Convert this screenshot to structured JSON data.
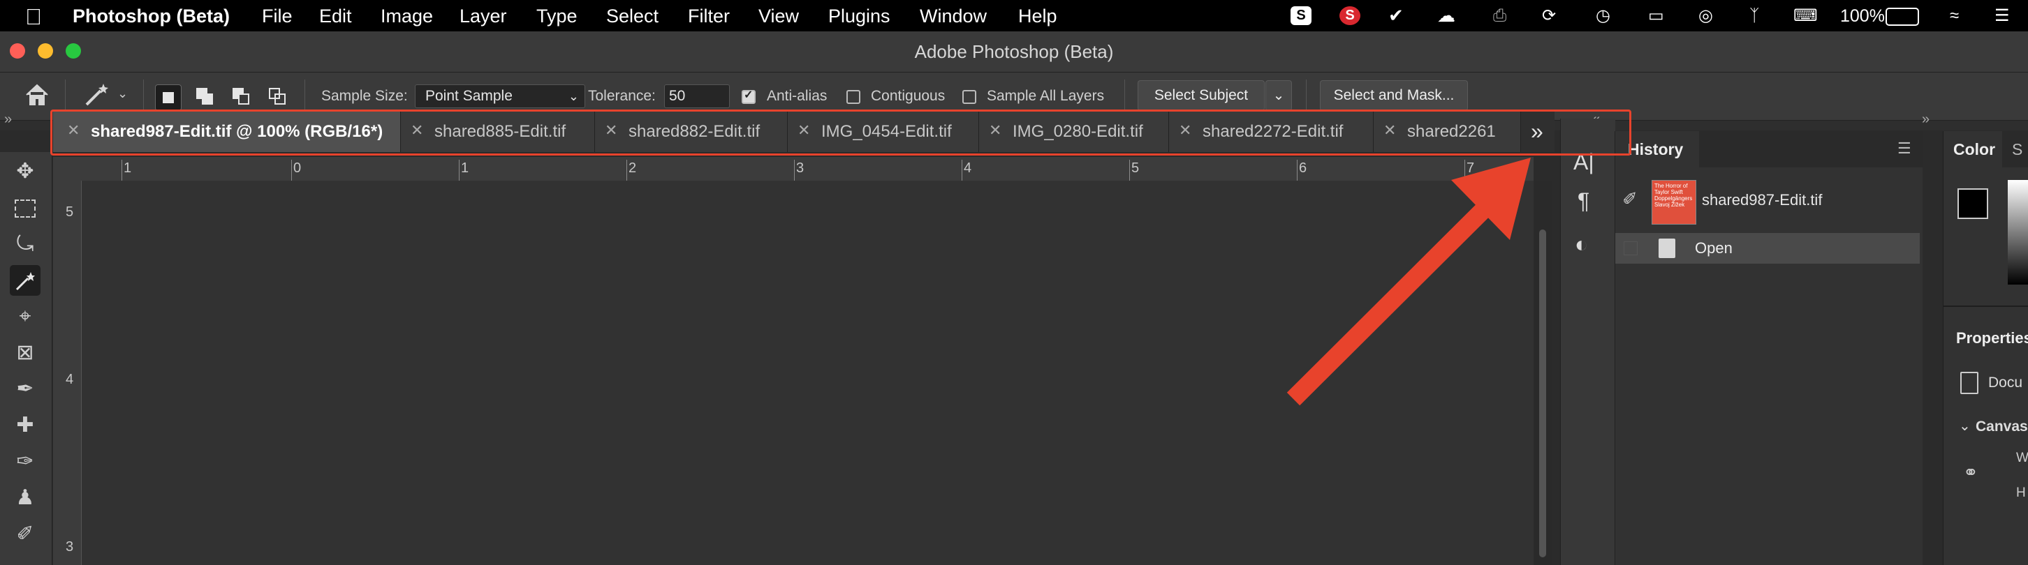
{
  "menubar": {
    "app": "Photoshop (Beta)",
    "items": [
      "File",
      "Edit",
      "Image",
      "Layer",
      "Type",
      "Select",
      "Filter",
      "View",
      "Plugins",
      "Window",
      "Help"
    ],
    "battery": "100%"
  },
  "window": {
    "title": "Adobe Photoshop (Beta)"
  },
  "options": {
    "sample_size_label": "Sample Size:",
    "sample_size_value": "Point Sample",
    "tolerance_label": "Tolerance:",
    "tolerance_value": "50",
    "anti_alias_label": "Anti-alias",
    "anti_alias_checked": true,
    "contiguous_label": "Contiguous",
    "contiguous_checked": false,
    "sample_all_label": "Sample All Layers",
    "sample_all_checked": false,
    "select_subject": "Select Subject",
    "select_and_mask": "Select and Mask..."
  },
  "tabs": [
    {
      "label": "shared987-Edit.tif @ 100% (RGB/16*)",
      "active": true
    },
    {
      "label": "shared885-Edit.tif",
      "active": false
    },
    {
      "label": "shared882-Edit.tif",
      "active": false
    },
    {
      "label": "IMG_0454-Edit.tif",
      "active": false
    },
    {
      "label": "IMG_0280-Edit.tif",
      "active": false
    },
    {
      "label": "shared2272-Edit.tif",
      "active": false
    },
    {
      "label": "shared2261",
      "active": false
    }
  ],
  "rulers": {
    "horizontal": [
      "1",
      "0",
      "1",
      "2",
      "3",
      "4",
      "5",
      "6",
      "7"
    ],
    "vertical": [
      "5",
      "4",
      "3"
    ]
  },
  "history": {
    "title": "History",
    "snapshot_name": "shared987-Edit.tif",
    "thumb_text": "The Horror of Taylor Swift Doppelgängers Slavoj Žižek",
    "steps": [
      "Open"
    ]
  },
  "color_panel": {
    "tab1": "Color",
    "tab2": "S"
  },
  "properties": {
    "title": "Properties",
    "doc_label": "Docu",
    "canvas_label": "Canvas",
    "w": "W",
    "h": "H"
  },
  "colors": {
    "accent_highlight": "#e8432c",
    "thumb_red": "#e0503c"
  }
}
